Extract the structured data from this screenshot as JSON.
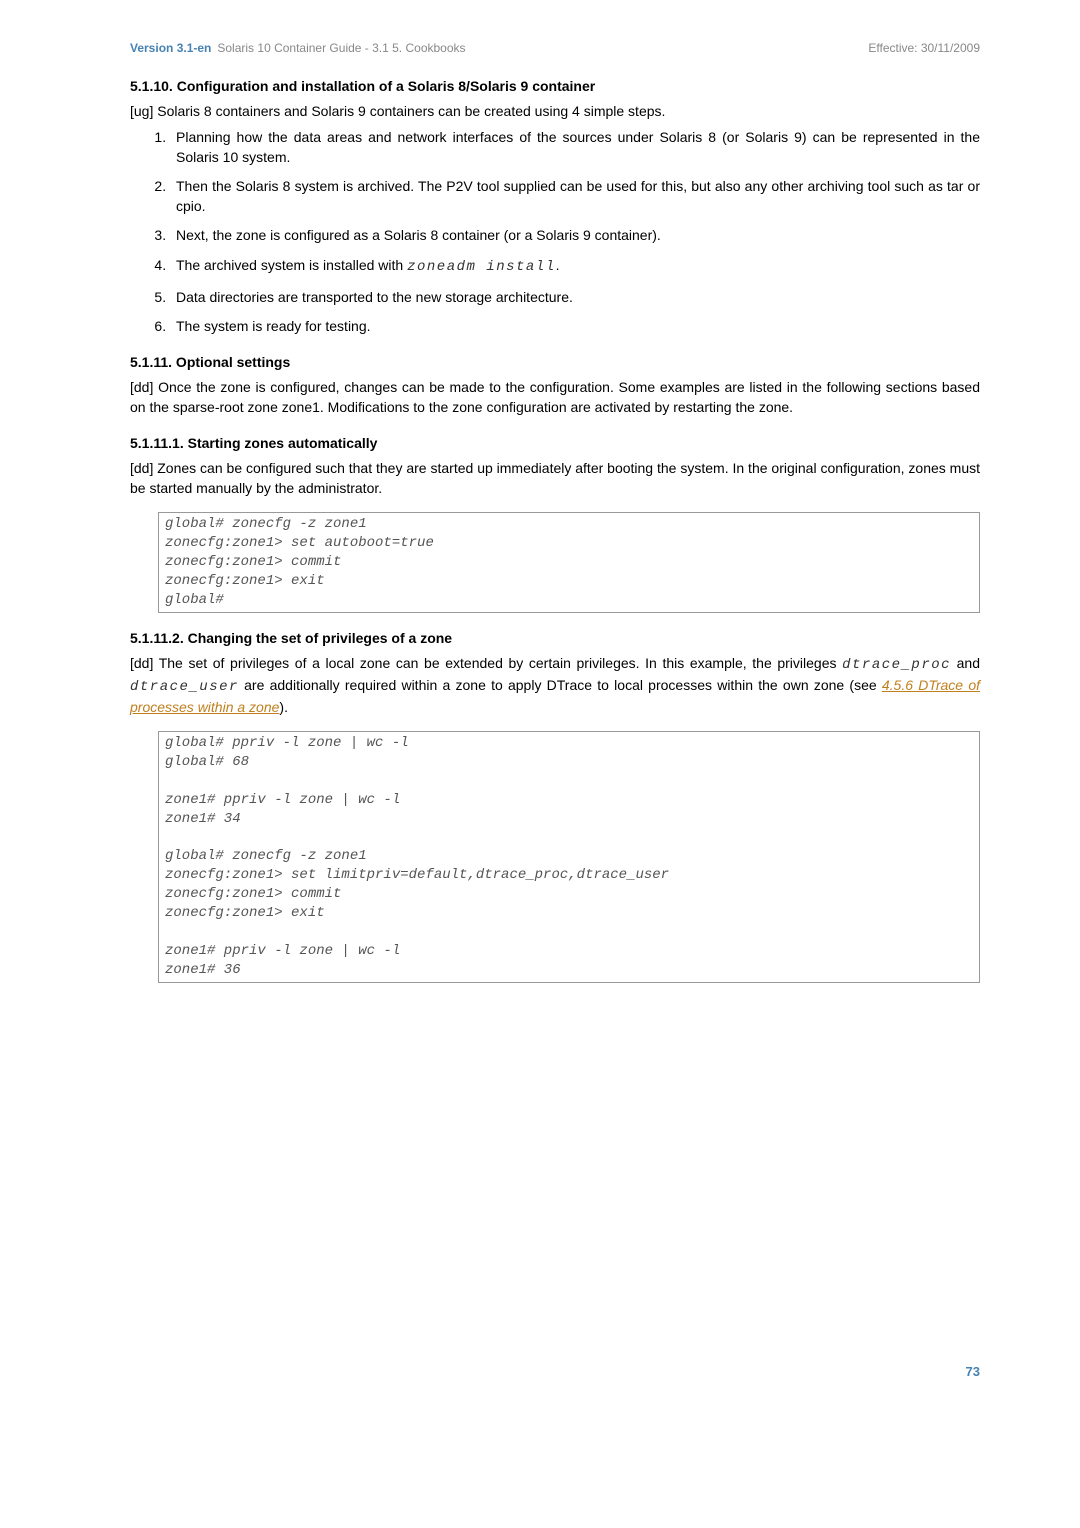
{
  "header": {
    "version": "Version 3.1-en",
    "title": "Solaris 10 Container Guide - 3.1   5. Cookbooks",
    "effective": "Effective: 30/11/2009"
  },
  "s1": {
    "heading": "5.1.10. Configuration and installation of a Solaris 8/Solaris 9 container",
    "intro": "[ug] Solaris 8 containers and Solaris 9 containers can be created using 4 simple steps.",
    "li1": "Planning how the data areas and network interfaces of the sources under Solaris 8 (or Solaris 9) can be represented in the Solaris 10 system.",
    "li2": "Then the Solaris 8 system is archived. The P2V tool supplied can be used for this, but also any other archiving tool such as tar or cpio.",
    "li3": "Next, the zone is configured as a Solaris 8 container (or a Solaris 9 container).",
    "li4a": "The archived system is installed with ",
    "li4b": "zoneadm install",
    "li4c": ".",
    "li5": "Data directories are transported to the new storage architecture.",
    "li6": "The system is ready for testing."
  },
  "s2": {
    "heading": "5.1.11. Optional settings",
    "para": "[dd] Once the zone is configured, changes can be made to the configuration. Some examples are listed in the following sections based on the sparse-root zone zone1. Modifications to the zone configuration are activated by restarting the zone."
  },
  "s3": {
    "heading": "5.1.11.1. Starting zones automatically",
    "para": "[dd] Zones can be configured such that they are started up immediately after booting the system. In the original configuration, zones must be started manually by the administrator.",
    "code": "global# zonecfg -z zone1\nzonecfg:zone1> set autoboot=true\nzonecfg:zone1> commit\nzonecfg:zone1> exit\nglobal#"
  },
  "s4": {
    "heading": "5.1.11.2. Changing the set of privileges of a zone",
    "p1a": "[dd] The set of privileges of a local zone can be extended by certain privileges. In this example, the privileges ",
    "p1b": "dtrace_proc",
    "p1c": " and ",
    "p1d": "dtrace_user",
    "p1e": " are additionally required within a zone to apply DTrace to local processes within the own zone (see ",
    "link": "4.5.6 DTrace of processes within a zone",
    "p1f": ").",
    "code": "global# ppriv -l zone | wc -l\nglobal# 68\n\nzone1# ppriv -l zone | wc -l\nzone1# 34\n\nglobal# zonecfg -z zone1\nzonecfg:zone1> set limitpriv=default,dtrace_proc,dtrace_user\nzonecfg:zone1> commit\nzonecfg:zone1> exit\n\nzone1# ppriv -l zone | wc -l\nzone1# 36"
  },
  "page": "73"
}
